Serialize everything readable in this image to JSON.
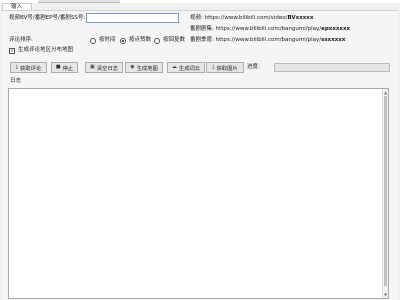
{
  "window": {
    "tab_label": "输入"
  },
  "input_section": {
    "video_id_label": "视频BV号/番剧EP号/番剧SS号:",
    "video_id_value": "",
    "sort_label": "评论排序:",
    "sort_options": [
      {
        "label": "按时间",
        "selected": false
      },
      {
        "label": "按点赞数",
        "selected": true
      },
      {
        "label": "按回复数",
        "selected": false
      }
    ],
    "generate_map_label": "生成评论地区分布地图",
    "generate_map_checked": true
  },
  "url_hints": {
    "video": {
      "prefix": "视频: https://www.bilibili.com/video/",
      "id": "BVxxxxx"
    },
    "episode": {
      "prefix": "番剧剧集: https://www.bilibili.com/bangumi/play/",
      "id": "epxxxxxx"
    },
    "season": {
      "prefix": "番剧季度: https://www.bilibili.com/bangumi/play/",
      "id": "ssxxxxx"
    }
  },
  "toolbar": {
    "buttons": [
      {
        "label": "获取评论",
        "icon": "download-icon"
      },
      {
        "label": "停止",
        "icon": "stop-icon"
      },
      {
        "label": "清空日志",
        "icon": "clear-icon"
      },
      {
        "label": "生成地图",
        "icon": "globe-icon"
      },
      {
        "label": "生成词云",
        "icon": "cloud-icon"
      },
      {
        "label": "获取图片",
        "icon": "image-download-icon"
      }
    ],
    "progress_label": "进度:",
    "progress_fraction": 0
  },
  "log": {
    "title": "日志",
    "text": ""
  },
  "colors": {
    "input_border": "#7a9ccc",
    "progress_fill": "#3c9c3c",
    "panel_bg": "#f5f5f5"
  }
}
